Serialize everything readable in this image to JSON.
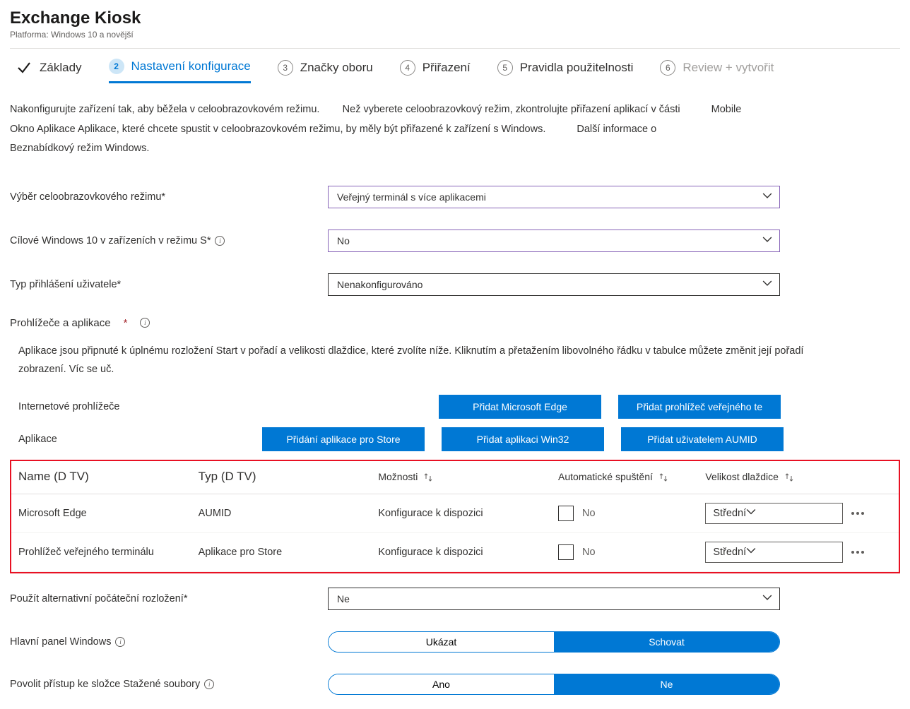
{
  "header": {
    "title": "Exchange Kiosk",
    "subtitle": "Platforma: Windows 10 a novější"
  },
  "steps": [
    {
      "label": "Základy",
      "type": "check"
    },
    {
      "label": "Nastavení konfigurace",
      "num": "2",
      "type": "active"
    },
    {
      "label": "Značky oboru",
      "num": "3",
      "type": "num"
    },
    {
      "label": "Přiřazení",
      "num": "4",
      "type": "num"
    },
    {
      "label": "Pravidla použitelnosti",
      "num": "5",
      "type": "num"
    },
    {
      "label": "Review + vytvořit",
      "num": "6",
      "type": "dim"
    }
  ],
  "description": {
    "line1a": "Nakonfigurujte zařízení tak, aby běžela v celoobrazovkovém režimu.",
    "line1b": "Než vyberete celoobrazovkový režim, zkontrolujte přiřazení aplikací v části",
    "mobile": "Mobile",
    "line2a": "Okno Aplikace Aplikace, které chcete spustit v celoobrazovkovém režimu, by měly být přiřazené k zařízení s Windows.",
    "line2b": "Další informace o",
    "line3": "Beznabídkový režim Windows."
  },
  "form": {
    "kiosk_mode": {
      "label": "Výběr celoobrazovkového režimu*",
      "value": "Veřejný terminál s více aplikacemi"
    },
    "target_s": {
      "label": "Cílové Windows 10 v zařízeních v režimu S*",
      "value": "No"
    },
    "logon_type": {
      "label": "Typ přihlášení uživatele*",
      "value": "Nenakonfigurováno"
    }
  },
  "browsers_section": {
    "label": "Prohlížeče a aplikace",
    "desc": "Aplikace jsou připnuté k úplnému rozložení Start v pořadí a velikosti dlaždice, které zvolíte níže. Kliknutím a přetažením libovolného řádku v tabulce můžete změnit její pořadí zobrazení. Víc se uč."
  },
  "button_rows": {
    "browsers_label": "Internetové prohlížeče",
    "apps_label": "Aplikace",
    "add_edge": "Přidat Microsoft Edge",
    "add_kiosk_browser": "Přidat prohlížeč veřejného te",
    "add_store": "Přidání aplikace pro Store",
    "add_win32": "Přidat aplikaci Win32",
    "add_aumid": "Přidat uživatelem AUMID"
  },
  "table": {
    "headers": {
      "name": "Name (D TV)",
      "type": "Typ (D TV)",
      "options": "Možnosti",
      "autolaunch": "Automatické spuštění",
      "tile": "Velikost dlaždice"
    },
    "rows": [
      {
        "name": "Microsoft Edge",
        "type": "AUMID",
        "options": "Konfigurace k dispozici",
        "auto": "No",
        "tile": "Střední"
      },
      {
        "name": "Prohlížeč veřejného terminálu",
        "type": "Aplikace pro Store",
        "options": "Konfigurace k dispozici",
        "auto": "No",
        "tile": "Střední"
      }
    ]
  },
  "alt_layout": {
    "label": "Použít alternativní počáteční rozložení*",
    "value": "Ne"
  },
  "taskbar": {
    "label": "Hlavní panel Windows",
    "opt1": "Ukázat",
    "opt2": "Schovat"
  },
  "downloads": {
    "label": "Povolit přístup ke složce Stažené soubory",
    "opt1": "Ano",
    "opt2": "Ne"
  }
}
